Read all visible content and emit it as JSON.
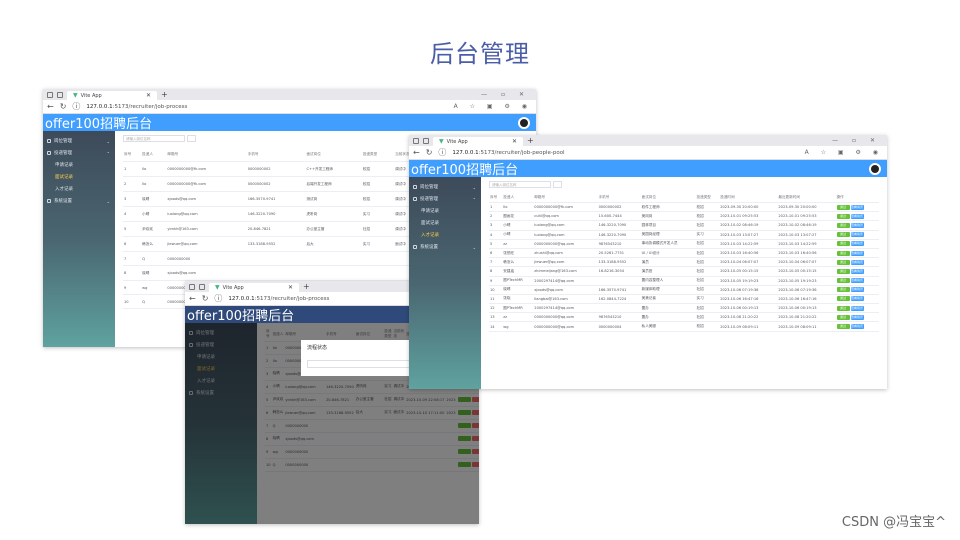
{
  "slide": {
    "title": "后台管理",
    "watermark": "CSDN @冯宝宝^"
  },
  "browser": {
    "tab_title": "Vite App",
    "url_host": "127.0.0.1",
    "url_process": ":5173/recruiter/job-process",
    "url_pool": ":5173/recruiter/job-people-pool"
  },
  "app": {
    "brand": "offer100招聘后台",
    "menu": [
      {
        "label": "岗位管理"
      },
      {
        "label": "投递管理"
      },
      {
        "label": "申请记录"
      },
      {
        "label": "面试记录"
      },
      {
        "label": "入才记录"
      },
      {
        "label": "系统设置"
      }
    ],
    "search_placeholder": "请输入岗位名称"
  },
  "process_table": {
    "headers": [
      "序号",
      "投递人",
      "邮箱号",
      "手机号",
      "面试岗位",
      "投递类型",
      "当前状态",
      "投递时间",
      "面试"
    ],
    "rows": [
      [
        "1",
        "llo",
        "0000000000@fk.com",
        "0000000002",
        "C++开发工程师",
        "校招",
        "调试中",
        "2023-09-30 19:35:40",
        "2023"
      ],
      [
        "2",
        "llo",
        "0000000000@fk.com",
        "0000000002",
        "后端开发工程师",
        "校招",
        "调试中",
        "2023-09-30 19:49:40",
        "2023"
      ],
      [
        "3",
        "晓晴",
        "xjoods@qq.com",
        "166-3570-9741",
        "测试岗",
        "校招",
        "调试中",
        "2023-10-07 20:40:27",
        "2023"
      ],
      [
        "4",
        "小晴",
        "luoiang@qq.com",
        "146-3220-7090",
        "虎听岗",
        "实习",
        "调试中",
        "2023-10-08 14:12:00",
        "2023"
      ],
      [
        "5",
        "尹欢欢",
        "yimkh@163.com",
        "20-846-7821",
        "办公室主管",
        "社招",
        "调试中",
        "2023-10-09 22:08:17",
        "2023"
      ],
      [
        "6",
        "韩怎么",
        "jiewuer@qq.com",
        "133-3188-9552",
        "后大",
        "实习",
        "面试中",
        "2023-10-10 17:11:00",
        "2023"
      ],
      [
        "7",
        "Q",
        "0000000000",
        "",
        "",
        "",
        "",
        "",
        ""
      ],
      [
        "8",
        "晓晴",
        "xjoods@qq.com",
        "",
        "",
        "",
        "",
        "",
        ""
      ],
      [
        "9",
        "wg",
        "0000000000",
        "",
        "",
        "",
        "",
        "",
        ""
      ],
      [
        "10",
        "Q",
        "0000000000",
        "",
        "",
        "",
        "",
        "",
        ""
      ]
    ]
  },
  "pool_table": {
    "headers": [
      "序号",
      "投递人",
      "邮箱号",
      "手机号",
      "面试岗位",
      "投递类型",
      "投递时间",
      "最近更新时间",
      "操作"
    ],
    "ops": {
      "pass": "通过",
      "detail": "查看简历"
    },
    "rows": [
      [
        "1",
        "llo",
        "0000000000@fk.com",
        "0000000002",
        "软件工程师",
        "校招",
        "2023-09-30 20:00:00",
        "2023-09-30 20:00:00"
      ],
      [
        "2",
        "图画花",
        "cuiti@qq.com",
        "15-600-7444",
        "美岗岗",
        "校招",
        "2023-10-01 09:25:53",
        "2023-10-01 09:25:53"
      ],
      [
        "3",
        "小晴",
        "luoiang@qq.com",
        "146-3220-7090",
        "园林项目",
        "社招",
        "2023-10-02 08:46:19",
        "2023-10-02 08:46:19"
      ],
      [
        "4",
        "小晴",
        "luoiang@qq.com",
        "146-3220-7090",
        "美园岗经理",
        "实习",
        "2023-10-03 13:07:27",
        "2023-10-03 13:07:27"
      ],
      [
        "5",
        "zz",
        "0000000000@qq.com",
        "9876543210",
        "事动协调模式开发人员",
        "社招",
        "2023-10-03 14:22:59",
        "2023-10-03 14:22:59"
      ],
      [
        "6",
        "张悦旺",
        "zhushi@qq.com",
        "20-5261-7751",
        "UI / UI设计",
        "社招",
        "2023-10-03 16:40:56",
        "2023-10-03 16:40:56"
      ],
      [
        "7",
        "韩怎么",
        "jiewuer@qq.com",
        "133-3188-9552",
        "演员",
        "社招",
        "2023-10-04 06:07:07",
        "2023-10-04 06:07:07"
      ],
      [
        "8",
        "安建庙",
        "zhimmeijang@163.com",
        "16-8216-3054",
        "演员官",
        "社招",
        "2023-10-05 00:15:15",
        "2023-10-05 00:15:15"
      ],
      [
        "9",
        "图PTechMR",
        "2000297414@qq.com",
        "",
        "置内容整理人",
        "社招",
        "2023-10-05 19:19:23",
        "2023-10-05 19:19:23"
      ],
      [
        "10",
        "晓晴",
        "xjoods@qq.com",
        "166-3570-9741",
        "新媒体助理",
        "社招",
        "2023-10-06 07:19:36",
        "2023-10-06 07:19:36"
      ],
      [
        "11",
        "张晓",
        "llangbai@163.com",
        "162-0844-7224",
        "美美记者",
        "实习",
        "2023-10-06 16:47:16",
        "2023-10-06 16:47:16"
      ],
      [
        "12",
        "图PTechMR",
        "2000297414@qq.com",
        "",
        "置办",
        "社招",
        "2023-10-06 00:19:13",
        "2023-10-06 00:19:13"
      ],
      [
        "13",
        "zz",
        "0000000000@qq.com",
        "9876543210",
        "置办",
        "社招",
        "2023-10-08 21:20:22",
        "2023-10-08 21:20:22"
      ],
      [
        "14",
        "wg",
        "0000000000@qq.com",
        "0000000004",
        "私人美服",
        "校招",
        "2023-10-09 08:09:11",
        "2023-10-09 08:09:11"
      ]
    ]
  },
  "modal": {
    "title": "流程状态"
  },
  "colors": {
    "header_blue": "#409eff",
    "title_blue": "#4a5da8",
    "btn_green": "#67c23a",
    "btn_red": "#f56c6c"
  }
}
